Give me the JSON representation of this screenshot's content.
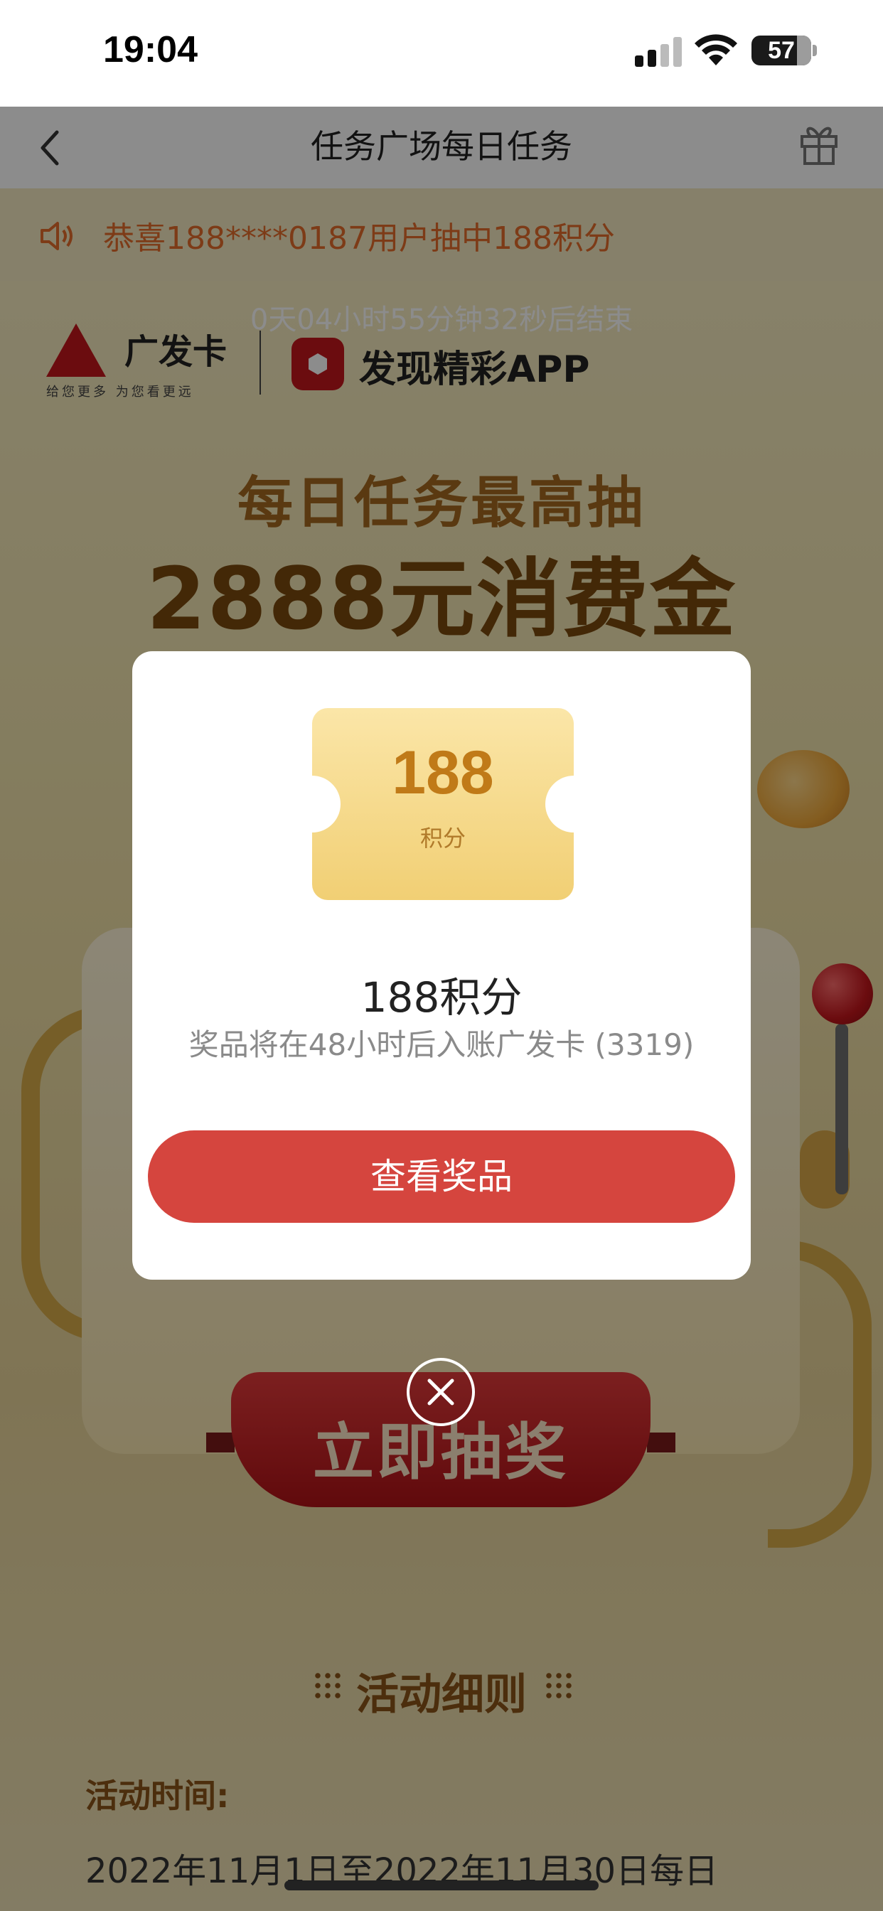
{
  "status": {
    "time": "19:04",
    "battery": "57"
  },
  "nav": {
    "title": "任务广场每日任务"
  },
  "banner": {
    "marquee": "恭喜188****0187用户抽中188积分",
    "countdown": "0天04小时55分钟32秒后结束",
    "brand_left": "广发卡",
    "brand_slogan": "给您更多 为您看更远",
    "brand_right": "发现精彩APP",
    "headline1": "每日任务最高抽",
    "headline2": "2888元消费金"
  },
  "machine": {
    "draw_button": "立即抽奖"
  },
  "rules": {
    "title": "活动细则",
    "time_label": "活动时间:",
    "time_text": "2022年11月1日至2022年11月30日每日"
  },
  "modal": {
    "coupon_value": "188",
    "coupon_unit": "积分",
    "prize_name": "188积分",
    "prize_desc": "奖品将在48小时后入账广发卡 (3319)",
    "view_button": "查看奖品"
  },
  "colors": {
    "accent_red": "#d5453e",
    "gold": "#c07a18",
    "brand_red": "#c4161c"
  }
}
